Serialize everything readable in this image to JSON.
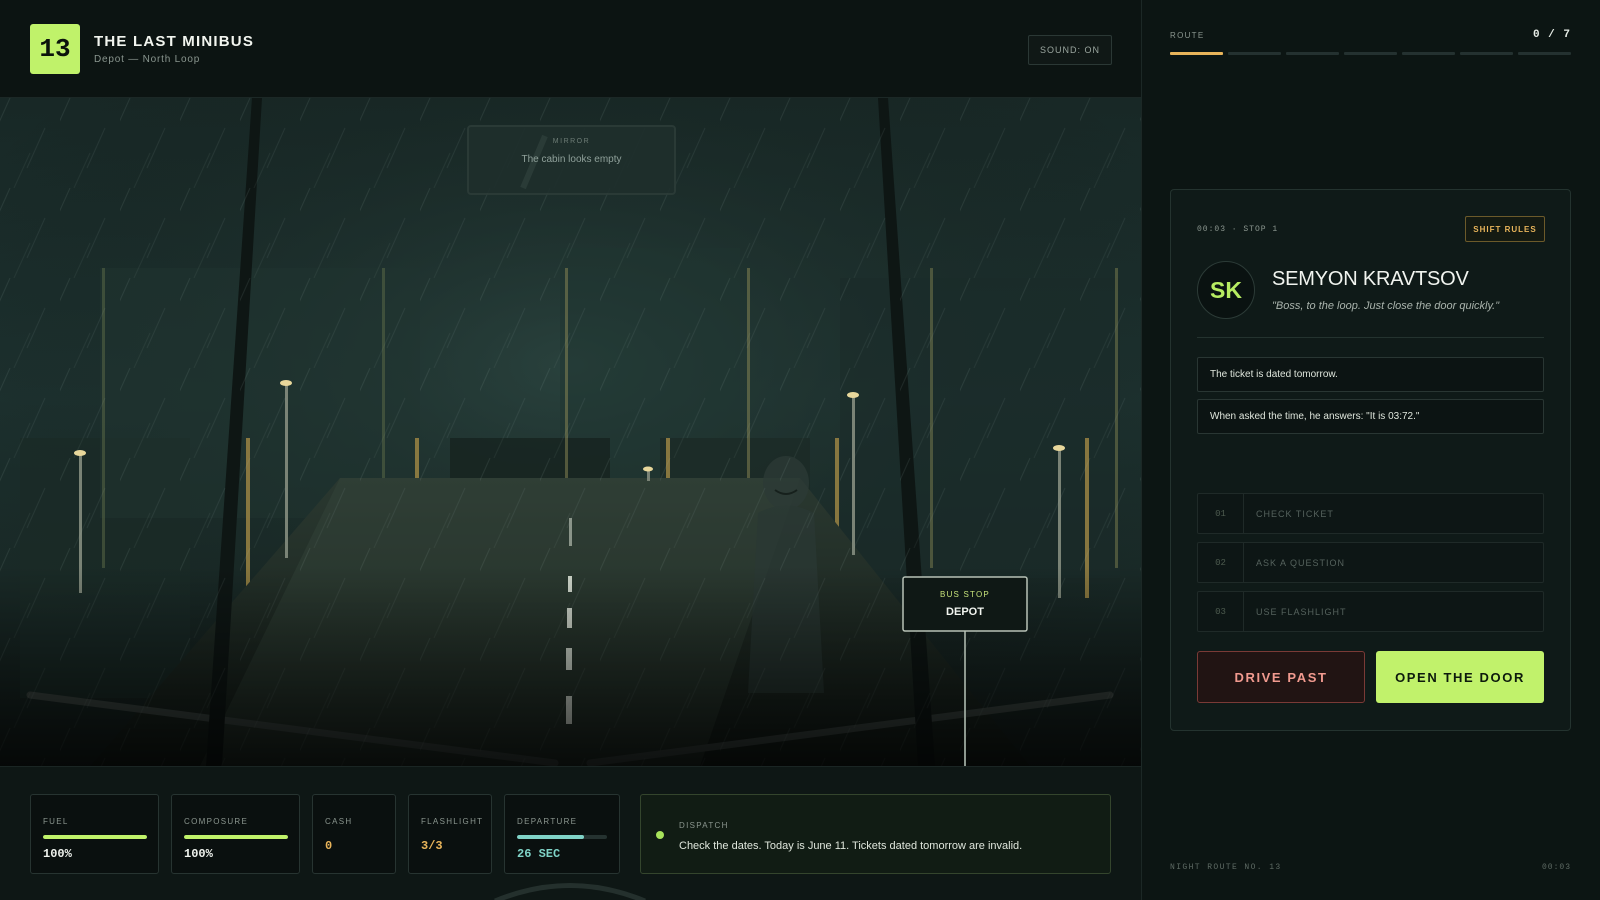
{
  "header": {
    "logo_number": "13",
    "title": "THE LAST MINIBUS",
    "subtitle": "Depot — North Loop",
    "sound_label": "SOUND: ON"
  },
  "scene": {
    "mirror_label": "MIRROR",
    "mirror_text": "The cabin looks empty",
    "bus_stop_label": "BUS STOP",
    "bus_stop_name": "DEPOT"
  },
  "stats": {
    "fuel": {
      "label": "FUEL",
      "value": "100%",
      "level": 1.0,
      "color": "#c0f26a"
    },
    "composure": {
      "label": "COMPOSURE",
      "value": "100%",
      "level": 1.0,
      "color": "#c0f26a"
    },
    "cash": {
      "label": "CASH",
      "value": "0",
      "color": "#e8b45a"
    },
    "flashlight": {
      "label": "FLASHLIGHT",
      "value": "3/3",
      "color": "#e8b45a"
    },
    "departure": {
      "label": "DEPARTURE",
      "value": "26 SEC",
      "level": 0.74,
      "color": "#7fd3c7"
    }
  },
  "dispatch": {
    "label": "DISPATCH",
    "text": "Check the dates. Today is June 11. Tickets dated tomorrow are invalid."
  },
  "route": {
    "label": "ROUTE",
    "progress": "0 / 7",
    "segments": 7,
    "active_segments": 1
  },
  "passenger": {
    "meta": "00:03 · STOP 1",
    "rules_label": "SHIFT RULES",
    "initials": "SK",
    "name": "SEMYON KRAVTSOV",
    "quote": "\"Boss, to the loop. Just close the door quickly.\"",
    "observations": [
      "The ticket is dated tomorrow.",
      "When asked the time, he answers: \"It is 03:72.\""
    ]
  },
  "actions": [
    {
      "num": "01",
      "label": "CHECK TICKET"
    },
    {
      "num": "02",
      "label": "ASK A QUESTION"
    },
    {
      "num": "03",
      "label": "USE FLASHLIGHT"
    }
  ],
  "decision": {
    "drive_past": "DRIVE PAST",
    "open_door": "OPEN THE DOOR"
  },
  "footer": {
    "route_name": "NIGHT ROUTE NO. 13",
    "clock": "00:03"
  },
  "colors": {
    "accent": "#c0f26a",
    "amber": "#e8b45a",
    "danger": "#f19a8f"
  }
}
